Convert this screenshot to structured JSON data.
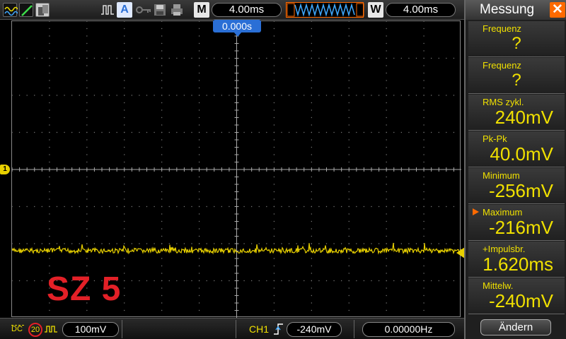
{
  "toolbar": {
    "icons": [
      "waveform-icon",
      "line-draw-icon",
      "persistence-icon",
      "pulse-icon",
      "auto-icon",
      "key-icon",
      "save-icon",
      "print-icon"
    ],
    "auto_label": "A",
    "m_label": "M",
    "m_timebase": "4.00ms",
    "w_label": "W",
    "w_timebase": "4.00ms"
  },
  "screen": {
    "time_offset": "0.000s",
    "ch1_marker": "1",
    "trace_label": "SZ 5",
    "trace_color": "#e8d000",
    "label_color": "#e32027"
  },
  "bottom": {
    "coupling": "DC",
    "bw_limit": "20",
    "ch1_scale": "100mV",
    "trigger_source": "CH1",
    "trigger_level": "-240mV",
    "frequency": "0.00000Hz"
  },
  "panel": {
    "title": "Messung",
    "close": "✕",
    "measurements": [
      {
        "name": "Frequenz",
        "value": "?"
      },
      {
        "name": "Frequenz",
        "value": "?"
      },
      {
        "name": "RMS  zykl.",
        "value": "240mV"
      },
      {
        "name": "Pk-Pk",
        "value": "40.0mV"
      },
      {
        "name": "Minimum",
        "value": "-256mV"
      },
      {
        "name": "Maximum",
        "value": "-216mV"
      },
      {
        "name": "+Impulsbr.",
        "value": "1.620ms"
      },
      {
        "name": "Mittelw.",
        "value": "-240mV"
      }
    ],
    "change_button": "Ändern"
  }
}
